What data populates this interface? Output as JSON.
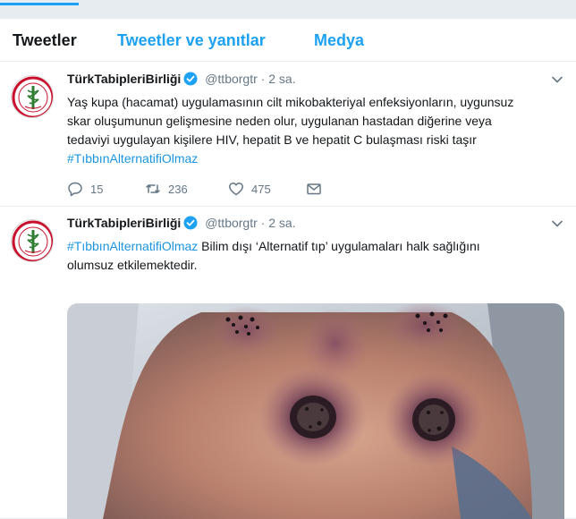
{
  "tabs": [
    {
      "label": "Tweetler"
    },
    {
      "label": "Tweetler ve yanıtlar"
    },
    {
      "label": "Medya"
    }
  ],
  "tweets": [
    {
      "name": "TürkTabipleriBirliği",
      "handle": "@ttborgtr",
      "separator": "·",
      "time": "2 sa.",
      "text_line1": "Yaş kupa (hacamat) uygulamasının cilt mikobakteriyal enfeksiyonların, uygunsuz",
      "text_line2": "skar oluşumunun gelişmesine neden olur, uygulanan hastadan diğerine veya",
      "text_line3": "tedaviyi uygulayan kişilere HIV, hepatit B ve hepatit C bulaşması riski taşır",
      "hashtag": "#TıbbınAlternatifiOlmaz",
      "replies": "15",
      "retweets": "236",
      "likes": "475"
    },
    {
      "name": "TürkTabipleriBirliği",
      "handle": "@ttborgtr",
      "separator": "·",
      "time": "2 sa.",
      "hashtag": "#TıbbınAlternatifiOlmaz",
      "text_rest_line1": " Bilim dışı ‘Alternatif tıp’ uygulamaları halk sağlığını",
      "text_line2": "olumsuz etkilemektedir."
    }
  ],
  "colors": {
    "accent": "#1da1f2",
    "link": "#1b95e0",
    "muted": "#657786",
    "text": "#14171a"
  }
}
